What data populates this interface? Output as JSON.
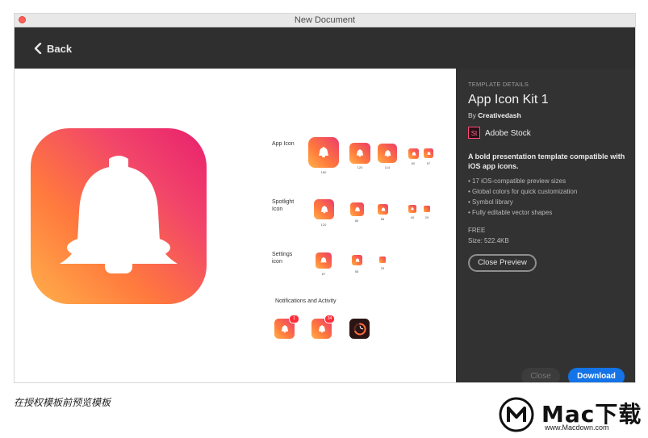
{
  "window": {
    "title": "New Document"
  },
  "toolbar": {
    "back_label": "Back"
  },
  "preview": {
    "rows": [
      {
        "label": "App Icon",
        "sizes": [
          "180",
          "120",
          "114",
          "60",
          "57"
        ]
      },
      {
        "label": "Spotlight Icon",
        "sizes": [
          "120",
          "80",
          "58",
          "40",
          "29"
        ]
      },
      {
        "label": "Settings icon",
        "sizes": [
          "87",
          "58",
          "29"
        ]
      },
      {
        "label": "Notifications and Activity",
        "badges": [
          "1",
          "34"
        ]
      }
    ]
  },
  "details": {
    "section": "TEMPLATE DETAILS",
    "title": "App Icon Kit 1",
    "author_prefix": "By",
    "author": "Creativedash",
    "stock_logo": "St",
    "stock_label": "Adobe Stock",
    "description": "A bold presentation template compatible with iOS app icons.",
    "bullets": [
      "17 iOS-compatible preview sizes",
      "Global colors for quick customization",
      "Symbol library",
      "Fully editable vector shapes"
    ],
    "price": "FREE",
    "size": "Size: 522.4KB",
    "close_preview_label": "Close Preview",
    "close_label": "Close",
    "download_label": "Download"
  },
  "caption": "在授权模板前预览模板",
  "watermark": {
    "main": "Mac下载",
    "url": "www.Macdown.com"
  },
  "colors": {
    "accent": "#1473e6",
    "icon_gradient_start": "#ffb04a",
    "icon_gradient_end": "#e8206e",
    "badge": "#ff2d3a",
    "sidebar_bg": "#323232"
  },
  "icons": {
    "back": "chevron-left-icon",
    "app_icon": "bell-icon",
    "activity": "ring-icon"
  }
}
